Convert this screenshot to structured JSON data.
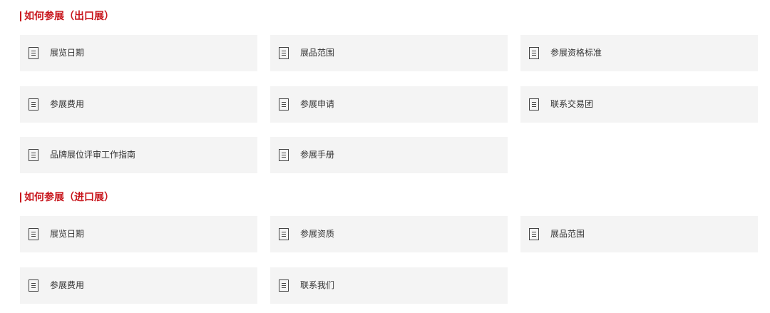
{
  "sections": [
    {
      "title": "如何参展（出口展）",
      "items": [
        {
          "label": "展览日期",
          "icon": "document-icon"
        },
        {
          "label": "展品范围",
          "icon": "document-icon"
        },
        {
          "label": "参展资格标准",
          "icon": "document-icon"
        },
        {
          "label": "参展费用",
          "icon": "document-icon"
        },
        {
          "label": "参展申请",
          "icon": "document-icon"
        },
        {
          "label": "联系交易团",
          "icon": "document-icon"
        },
        {
          "label": "品牌展位评审工作指南",
          "icon": "document-icon"
        },
        {
          "label": "参展手册",
          "icon": "document-icon"
        }
      ]
    },
    {
      "title": "如何参展（进口展）",
      "items": [
        {
          "label": "展览日期",
          "icon": "document-icon"
        },
        {
          "label": "参展资质",
          "icon": "document-icon"
        },
        {
          "label": "展品范围",
          "icon": "document-icon"
        },
        {
          "label": "参展费用",
          "icon": "document-icon"
        },
        {
          "label": "联系我们",
          "icon": "document-icon"
        }
      ]
    }
  ],
  "colors": {
    "accent": "#c8161d",
    "card_background": "#f4f4f4",
    "text": "#333333"
  }
}
